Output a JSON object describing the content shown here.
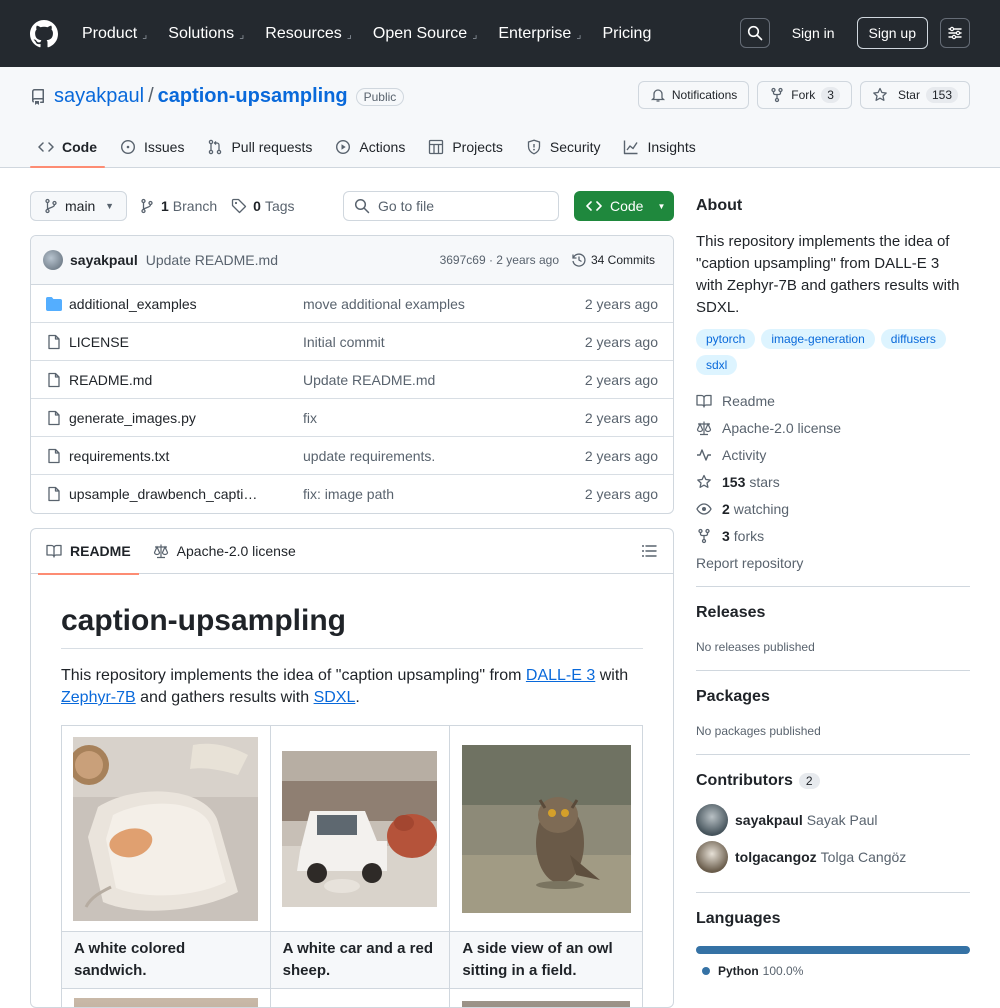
{
  "nav": {
    "items": [
      "Product",
      "Solutions",
      "Resources",
      "Open Source",
      "Enterprise",
      "Pricing"
    ],
    "sign_in": "Sign in",
    "sign_up": "Sign up"
  },
  "repo": {
    "owner": "sayakpaul",
    "separator": "/",
    "name": "caption-upsampling",
    "visibility": "Public",
    "notifications": "Notifications",
    "fork": "Fork",
    "fork_count": "3",
    "star": "Star",
    "star_count": "153"
  },
  "tabs": [
    "Code",
    "Issues",
    "Pull requests",
    "Actions",
    "Projects",
    "Security",
    "Insights"
  ],
  "bar": {
    "branch": "main",
    "branch_count": "1",
    "branch_label": "Branch",
    "tag_count": "0",
    "tag_label": "Tags",
    "go_to_file": "Go to file",
    "code": "Code"
  },
  "commit": {
    "author": "sayakpaul",
    "message": "Update README.md",
    "hash": "3697c69 · 2 years ago",
    "commits": "34 Commits"
  },
  "files": [
    {
      "type": "dir",
      "name": "additional_examples",
      "msg": "move additional examples",
      "date": "2 years ago"
    },
    {
      "type": "file",
      "name": "LICENSE",
      "msg": "Initial commit",
      "date": "2 years ago"
    },
    {
      "type": "file",
      "name": "README.md",
      "msg": "Update README.md",
      "date": "2 years ago"
    },
    {
      "type": "file",
      "name": "generate_images.py",
      "msg": "fix",
      "date": "2 years ago"
    },
    {
      "type": "file",
      "name": "requirements.txt",
      "msg": "update requirements.",
      "date": "2 years ago"
    },
    {
      "type": "file",
      "name": "upsample_drawbench_captions.…",
      "msg": "fix: image path",
      "date": "2 years ago"
    }
  ],
  "readme": {
    "tab_readme": "README",
    "tab_license": "Apache-2.0 license",
    "title": "caption-upsampling",
    "p1": "This repository implements the idea of \"caption upsampling\" from ",
    "link1": "DALL-E 3",
    "p2": " with ",
    "link2": "Zephyr-7B",
    "p3": " and gathers results with ",
    "link3": "SDXL",
    "p4": ".",
    "captions": [
      "A white colored sandwich.",
      "A white car and a red sheep.",
      "A side view of an owl sitting in a field."
    ]
  },
  "about": {
    "title": "About",
    "description": "This repository implements the idea of \"caption upsampling\" from DALL-E 3 with Zephyr-7B and gathers results with SDXL.",
    "topics": [
      "pytorch",
      "image-generation",
      "diffusers",
      "sdxl"
    ],
    "readme": "Readme",
    "license": "Apache-2.0 license",
    "activity": "Activity",
    "stars": "153",
    "stars_label": "stars",
    "watching": "2",
    "watching_label": "watching",
    "forks": "3",
    "forks_label": "forks",
    "report": "Report repository"
  },
  "releases": {
    "title": "Releases",
    "empty": "No releases published"
  },
  "packages": {
    "title": "Packages",
    "empty": "No packages published"
  },
  "contributors": {
    "title": "Contributors",
    "count": "2",
    "people": [
      {
        "login": "sayakpaul",
        "name": "Sayak Paul"
      },
      {
        "login": "tolgacangoz",
        "name": "Tolga Cangöz"
      }
    ]
  },
  "languages": {
    "title": "Languages",
    "items": [
      {
        "name": "Python",
        "pct": "100.0%",
        "color": "#3572a5"
      }
    ]
  },
  "colors": {
    "header_bg": "#24292f",
    "link": "#0969da",
    "green": "#1f883d",
    "tab_underline": "#fd8c73"
  }
}
